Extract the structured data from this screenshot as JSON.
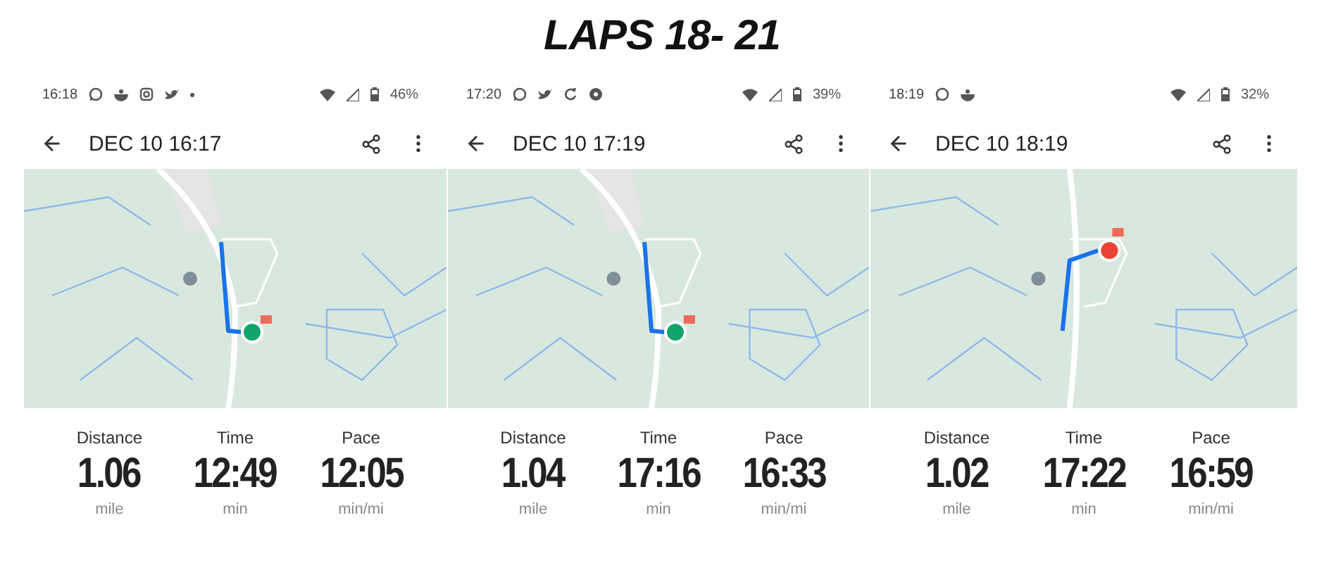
{
  "title": "LAPS 18- 21",
  "screens": [
    {
      "status": {
        "time": "16:18",
        "battery": "46%",
        "notifications": [
          {
            "kind": "chat"
          },
          {
            "kind": "bowl"
          },
          {
            "kind": "camera"
          },
          {
            "kind": "bird"
          },
          {
            "kind": "dot"
          }
        ]
      },
      "header": {
        "title": "DEC 10 16:17"
      },
      "map": {
        "kind": "picture"
      },
      "stats": [
        {
          "label": "Distance",
          "value": "1.06",
          "unit": "mile"
        },
        {
          "label": "Time",
          "value": "12:49",
          "unit": "min"
        },
        {
          "label": "Pace",
          "value": "12:05",
          "unit": "min/mi"
        }
      ]
    },
    {
      "status": {
        "time": "17:20",
        "battery": "39%",
        "notifications": [
          {
            "kind": "chat"
          },
          {
            "kind": "bird"
          },
          {
            "kind": "sync"
          },
          {
            "kind": "ball"
          }
        ]
      },
      "header": {
        "title": "DEC 10 17:19"
      },
      "map": {
        "kind": "picture"
      },
      "stats": [
        {
          "label": "Distance",
          "value": "1.04",
          "unit": "mile"
        },
        {
          "label": "Time",
          "value": "17:16",
          "unit": "min"
        },
        {
          "label": "Pace",
          "value": "16:33",
          "unit": "min/mi"
        }
      ]
    },
    {
      "status": {
        "time": "18:19",
        "battery": "32%",
        "notifications": [
          {
            "kind": "chat"
          },
          {
            "kind": "bowl"
          }
        ]
      },
      "header": {
        "title": "DEC 10 18:19"
      },
      "map": {
        "kind": "picture"
      },
      "stats": [
        {
          "label": "Distance",
          "value": "1.02",
          "unit": "mile"
        },
        {
          "label": "Time",
          "value": "17:22",
          "unit": "min"
        },
        {
          "label": "Pace",
          "value": "16:59",
          "unit": "min/mi"
        }
      ]
    }
  ]
}
